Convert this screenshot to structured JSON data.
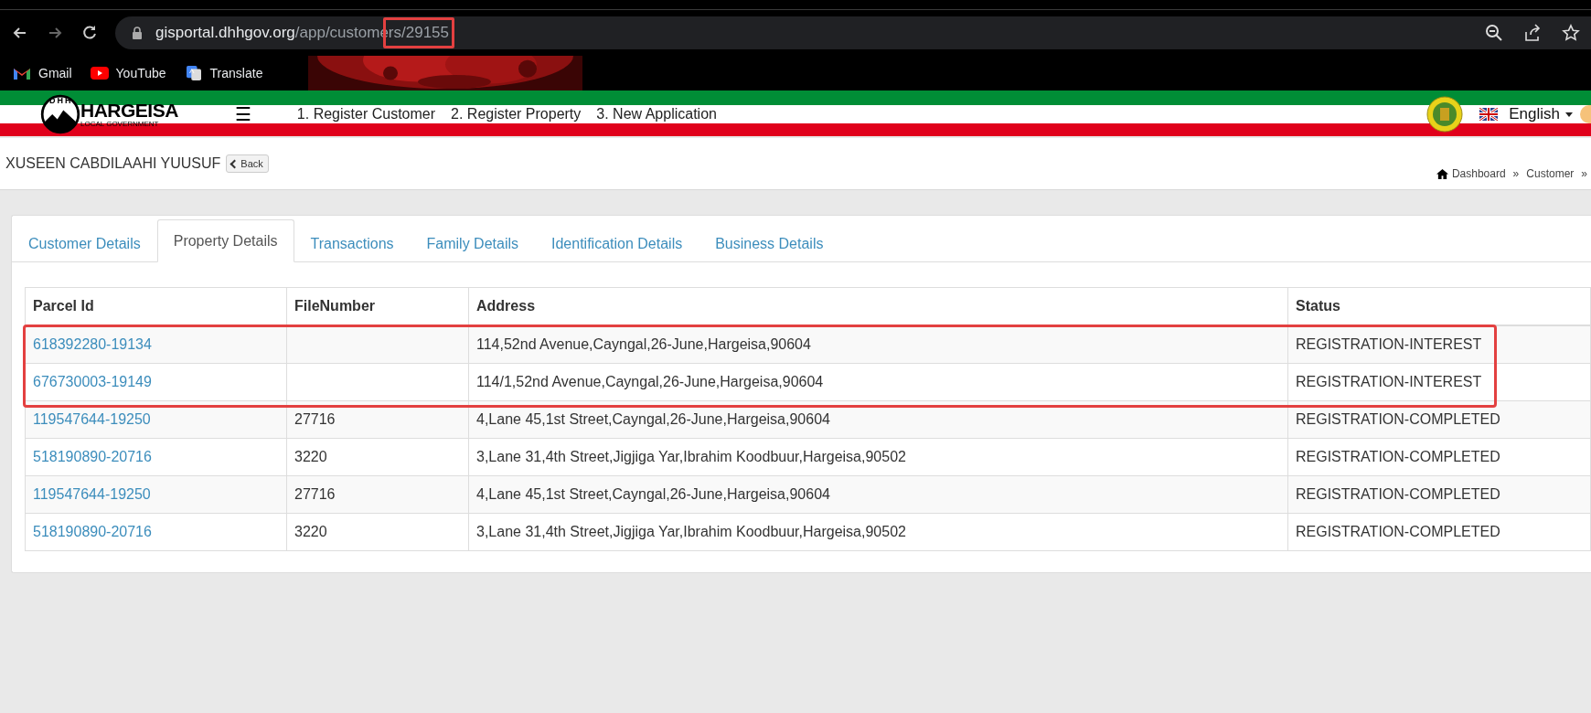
{
  "browser": {
    "url": [
      {
        "text": "gisportal.dhhgov.org",
        "kind": "host",
        "highlighted": false
      },
      {
        "text": "/app/custome",
        "kind": "path",
        "highlighted": false
      },
      {
        "text": "rs/29155",
        "kind": "path",
        "highlighted": true
      }
    ],
    "bookmarks": [
      {
        "label": "Gmail",
        "kind": "gmail"
      },
      {
        "label": "YouTube",
        "kind": "youtube"
      },
      {
        "label": "Translate",
        "kind": "translate"
      }
    ]
  },
  "header": {
    "logo_name": "HARGEISA",
    "logo_sub": "LOCAL GOVERNMENT",
    "logo_letters": "DHH",
    "menu_icon": "☰",
    "nav": [
      "1. Register Customer",
      "2. Register Property",
      "3. New Application"
    ],
    "language": "English"
  },
  "page": {
    "title": "XUSEEN CABDILAAHI YUUSUF",
    "back_button": "Back",
    "breadcrumbs": [
      "Dashboard",
      "»",
      "Customer",
      "»"
    ]
  },
  "tabs": [
    {
      "label": "Customer Details",
      "selected": false
    },
    {
      "label": "Property Details",
      "selected": true
    },
    {
      "label": "Transactions",
      "selected": false
    },
    {
      "label": "Family Details",
      "selected": false
    },
    {
      "label": "Identification Details",
      "selected": false
    },
    {
      "label": "Business Details",
      "selected": false
    }
  ],
  "table": {
    "columns": [
      "Parcel Id",
      "FileNumber",
      "Address",
      "Status"
    ],
    "rows": [
      {
        "parcel_id": "618392280-19134",
        "file_number": "",
        "address": "114,52nd Avenue,Cayngal,26-June,Hargeisa,90604",
        "status": "REGISTRATION-INTEREST",
        "highlighted": true
      },
      {
        "parcel_id": "676730003-19149",
        "file_number": "",
        "address": "114/1,52nd Avenue,Cayngal,26-June,Hargeisa,90604",
        "status": "REGISTRATION-INTEREST",
        "highlighted": true
      },
      {
        "parcel_id": "119547644-19250",
        "file_number": "27716",
        "address": "4,Lane 45,1st Street,Cayngal,26-June,Hargeisa,90604",
        "status": "REGISTRATION-COMPLETED",
        "highlighted": false
      },
      {
        "parcel_id": "518190890-20716",
        "file_number": "3220",
        "address": "3,Lane 31,4th Street,Jigjiga Yar,Ibrahim Koodbuur,Hargeisa,90502",
        "status": "REGISTRATION-COMPLETED",
        "highlighted": false
      },
      {
        "parcel_id": "119547644-19250",
        "file_number": "27716",
        "address": "4,Lane 45,1st Street,Cayngal,26-June,Hargeisa,90604",
        "status": "REGISTRATION-COMPLETED",
        "highlighted": false
      },
      {
        "parcel_id": "518190890-20716",
        "file_number": "3220",
        "address": "3,Lane 31,4th Street,Jigjiga Yar,Ibrahim Koodbuur,Hargeisa,90502",
        "status": "REGISTRATION-COMPLETED",
        "highlighted": false
      }
    ]
  }
}
